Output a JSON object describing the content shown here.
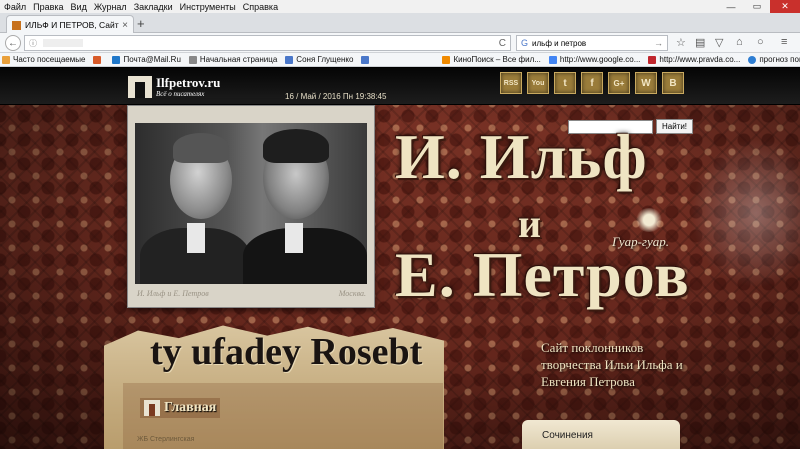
{
  "menubar": {
    "items": [
      "Файл",
      "Правка",
      "Вид",
      "Журнал",
      "Закладки",
      "Инструменты",
      "Справка"
    ]
  },
  "window_controls": {
    "minimize": "—",
    "maximize": "▭",
    "close": "✕"
  },
  "tab": {
    "title": "ИЛЬФ И ПЕТРОВ, Сайт п...",
    "close": "×",
    "new": "+"
  },
  "navbar": {
    "search_value": "ильф и петров",
    "search_engine": "G",
    "go": "→",
    "reload": "C",
    "info": "ⓘ"
  },
  "bookmarks": [
    {
      "label": "Часто посещаемые",
      "color": "#e9a03b"
    },
    {
      "label": "",
      "color": "#d85b2a"
    },
    {
      "label": "Почта@Mail.Ru",
      "color": "#1f77c9"
    },
    {
      "label": "Начальная страница",
      "color": "#888888"
    },
    {
      "label": "Соня Глущенко",
      "color": "#4a77c9"
    },
    {
      "label": "",
      "color": "#4a77c9"
    },
    {
      "label": "КиноПоиск – Все фил...",
      "color": "#f08a00"
    },
    {
      "label": "http://www.google.co...",
      "color": "#4285f4"
    },
    {
      "label": "http://www.pravda.co...",
      "color": "#c0262d"
    },
    {
      "label": "прогноз погоды",
      "color": "#2d7dd2"
    }
  ],
  "site": {
    "logo_title": "Ilfpetrov.ru",
    "logo_sub": "Всё о писателях",
    "date": "16 / Май / 2016 Пн 19:38:45",
    "social": [
      "RSS",
      "You",
      "t",
      "f",
      "G+",
      "W",
      "B"
    ],
    "search_button": "Найти!",
    "photo_caption_left": "И. Ильф и Е. Петров",
    "photo_caption_right": "Москва.",
    "title_line1": "И. Ильф",
    "title_and": "и",
    "title_line2": "Е. Петров",
    "tuar": "Гуар-гуар.",
    "banner_text": "ty ufadey Rosebt",
    "nav_main": "Главная",
    "jk": "ЖБ Стерлингская",
    "tagline": "Сайт поклонников творчества Ильи Ильфа и Евгения Петрова",
    "works_tab": "Сочинения"
  }
}
